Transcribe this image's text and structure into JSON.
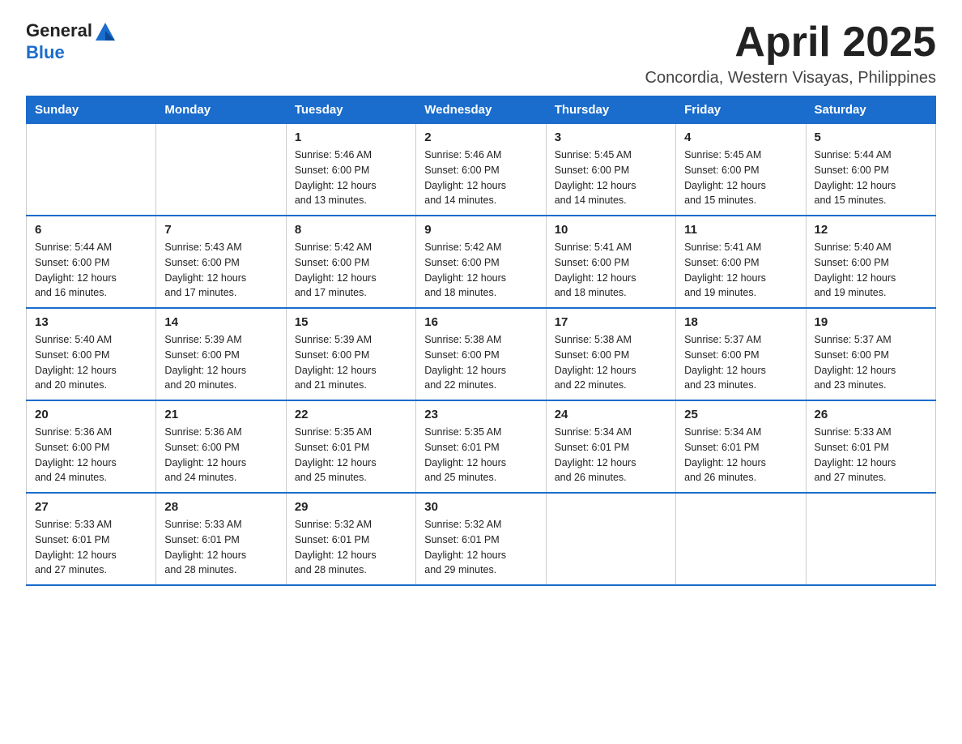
{
  "logo": {
    "general": "General",
    "blue": "Blue"
  },
  "title": "April 2025",
  "location": "Concordia, Western Visayas, Philippines",
  "weekdays": [
    "Sunday",
    "Monday",
    "Tuesday",
    "Wednesday",
    "Thursday",
    "Friday",
    "Saturday"
  ],
  "weeks": [
    [
      {
        "day": "",
        "info": ""
      },
      {
        "day": "",
        "info": ""
      },
      {
        "day": "1",
        "info": "Sunrise: 5:46 AM\nSunset: 6:00 PM\nDaylight: 12 hours\nand 13 minutes."
      },
      {
        "day": "2",
        "info": "Sunrise: 5:46 AM\nSunset: 6:00 PM\nDaylight: 12 hours\nand 14 minutes."
      },
      {
        "day": "3",
        "info": "Sunrise: 5:45 AM\nSunset: 6:00 PM\nDaylight: 12 hours\nand 14 minutes."
      },
      {
        "day": "4",
        "info": "Sunrise: 5:45 AM\nSunset: 6:00 PM\nDaylight: 12 hours\nand 15 minutes."
      },
      {
        "day": "5",
        "info": "Sunrise: 5:44 AM\nSunset: 6:00 PM\nDaylight: 12 hours\nand 15 minutes."
      }
    ],
    [
      {
        "day": "6",
        "info": "Sunrise: 5:44 AM\nSunset: 6:00 PM\nDaylight: 12 hours\nand 16 minutes."
      },
      {
        "day": "7",
        "info": "Sunrise: 5:43 AM\nSunset: 6:00 PM\nDaylight: 12 hours\nand 17 minutes."
      },
      {
        "day": "8",
        "info": "Sunrise: 5:42 AM\nSunset: 6:00 PM\nDaylight: 12 hours\nand 17 minutes."
      },
      {
        "day": "9",
        "info": "Sunrise: 5:42 AM\nSunset: 6:00 PM\nDaylight: 12 hours\nand 18 minutes."
      },
      {
        "day": "10",
        "info": "Sunrise: 5:41 AM\nSunset: 6:00 PM\nDaylight: 12 hours\nand 18 minutes."
      },
      {
        "day": "11",
        "info": "Sunrise: 5:41 AM\nSunset: 6:00 PM\nDaylight: 12 hours\nand 19 minutes."
      },
      {
        "day": "12",
        "info": "Sunrise: 5:40 AM\nSunset: 6:00 PM\nDaylight: 12 hours\nand 19 minutes."
      }
    ],
    [
      {
        "day": "13",
        "info": "Sunrise: 5:40 AM\nSunset: 6:00 PM\nDaylight: 12 hours\nand 20 minutes."
      },
      {
        "day": "14",
        "info": "Sunrise: 5:39 AM\nSunset: 6:00 PM\nDaylight: 12 hours\nand 20 minutes."
      },
      {
        "day": "15",
        "info": "Sunrise: 5:39 AM\nSunset: 6:00 PM\nDaylight: 12 hours\nand 21 minutes."
      },
      {
        "day": "16",
        "info": "Sunrise: 5:38 AM\nSunset: 6:00 PM\nDaylight: 12 hours\nand 22 minutes."
      },
      {
        "day": "17",
        "info": "Sunrise: 5:38 AM\nSunset: 6:00 PM\nDaylight: 12 hours\nand 22 minutes."
      },
      {
        "day": "18",
        "info": "Sunrise: 5:37 AM\nSunset: 6:00 PM\nDaylight: 12 hours\nand 23 minutes."
      },
      {
        "day": "19",
        "info": "Sunrise: 5:37 AM\nSunset: 6:00 PM\nDaylight: 12 hours\nand 23 minutes."
      }
    ],
    [
      {
        "day": "20",
        "info": "Sunrise: 5:36 AM\nSunset: 6:00 PM\nDaylight: 12 hours\nand 24 minutes."
      },
      {
        "day": "21",
        "info": "Sunrise: 5:36 AM\nSunset: 6:00 PM\nDaylight: 12 hours\nand 24 minutes."
      },
      {
        "day": "22",
        "info": "Sunrise: 5:35 AM\nSunset: 6:01 PM\nDaylight: 12 hours\nand 25 minutes."
      },
      {
        "day": "23",
        "info": "Sunrise: 5:35 AM\nSunset: 6:01 PM\nDaylight: 12 hours\nand 25 minutes."
      },
      {
        "day": "24",
        "info": "Sunrise: 5:34 AM\nSunset: 6:01 PM\nDaylight: 12 hours\nand 26 minutes."
      },
      {
        "day": "25",
        "info": "Sunrise: 5:34 AM\nSunset: 6:01 PM\nDaylight: 12 hours\nand 26 minutes."
      },
      {
        "day": "26",
        "info": "Sunrise: 5:33 AM\nSunset: 6:01 PM\nDaylight: 12 hours\nand 27 minutes."
      }
    ],
    [
      {
        "day": "27",
        "info": "Sunrise: 5:33 AM\nSunset: 6:01 PM\nDaylight: 12 hours\nand 27 minutes."
      },
      {
        "day": "28",
        "info": "Sunrise: 5:33 AM\nSunset: 6:01 PM\nDaylight: 12 hours\nand 28 minutes."
      },
      {
        "day": "29",
        "info": "Sunrise: 5:32 AM\nSunset: 6:01 PM\nDaylight: 12 hours\nand 28 minutes."
      },
      {
        "day": "30",
        "info": "Sunrise: 5:32 AM\nSunset: 6:01 PM\nDaylight: 12 hours\nand 29 minutes."
      },
      {
        "day": "",
        "info": ""
      },
      {
        "day": "",
        "info": ""
      },
      {
        "day": "",
        "info": ""
      }
    ]
  ]
}
